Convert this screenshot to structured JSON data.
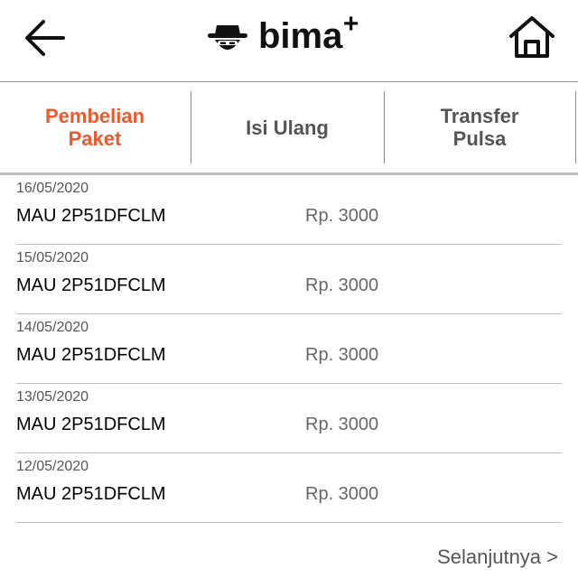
{
  "header": {
    "logo_text": "bima",
    "logo_plus": "+",
    "back_icon": "arrow-left-icon",
    "home_icon": "home-icon"
  },
  "tabs": [
    {
      "label_line1": "Pembelian",
      "label_line2": "Paket",
      "active": true
    },
    {
      "label_line1": "Isi Ulang",
      "label_line2": "",
      "active": false
    },
    {
      "label_line1": "Transfer",
      "label_line2": "Pulsa",
      "active": false
    }
  ],
  "transactions": [
    {
      "date": "16/05/2020",
      "code": "MAU 2P51DFCLM",
      "price": "Rp. 3000"
    },
    {
      "date": "15/05/2020",
      "code": "MAU 2P51DFCLM",
      "price": "Rp. 3000"
    },
    {
      "date": "14/05/2020",
      "code": "MAU 2P51DFCLM",
      "price": "Rp. 3000"
    },
    {
      "date": "13/05/2020",
      "code": "MAU 2P51DFCLM",
      "price": "Rp. 3000"
    },
    {
      "date": "12/05/2020",
      "code": "MAU 2P51DFCLM",
      "price": "Rp. 3000"
    }
  ],
  "footer": {
    "next_label": "Selanjutnya >"
  },
  "colors": {
    "accent": "#ea5a2e",
    "tab_inactive": "#555555",
    "divider": "#bdbdbd"
  }
}
